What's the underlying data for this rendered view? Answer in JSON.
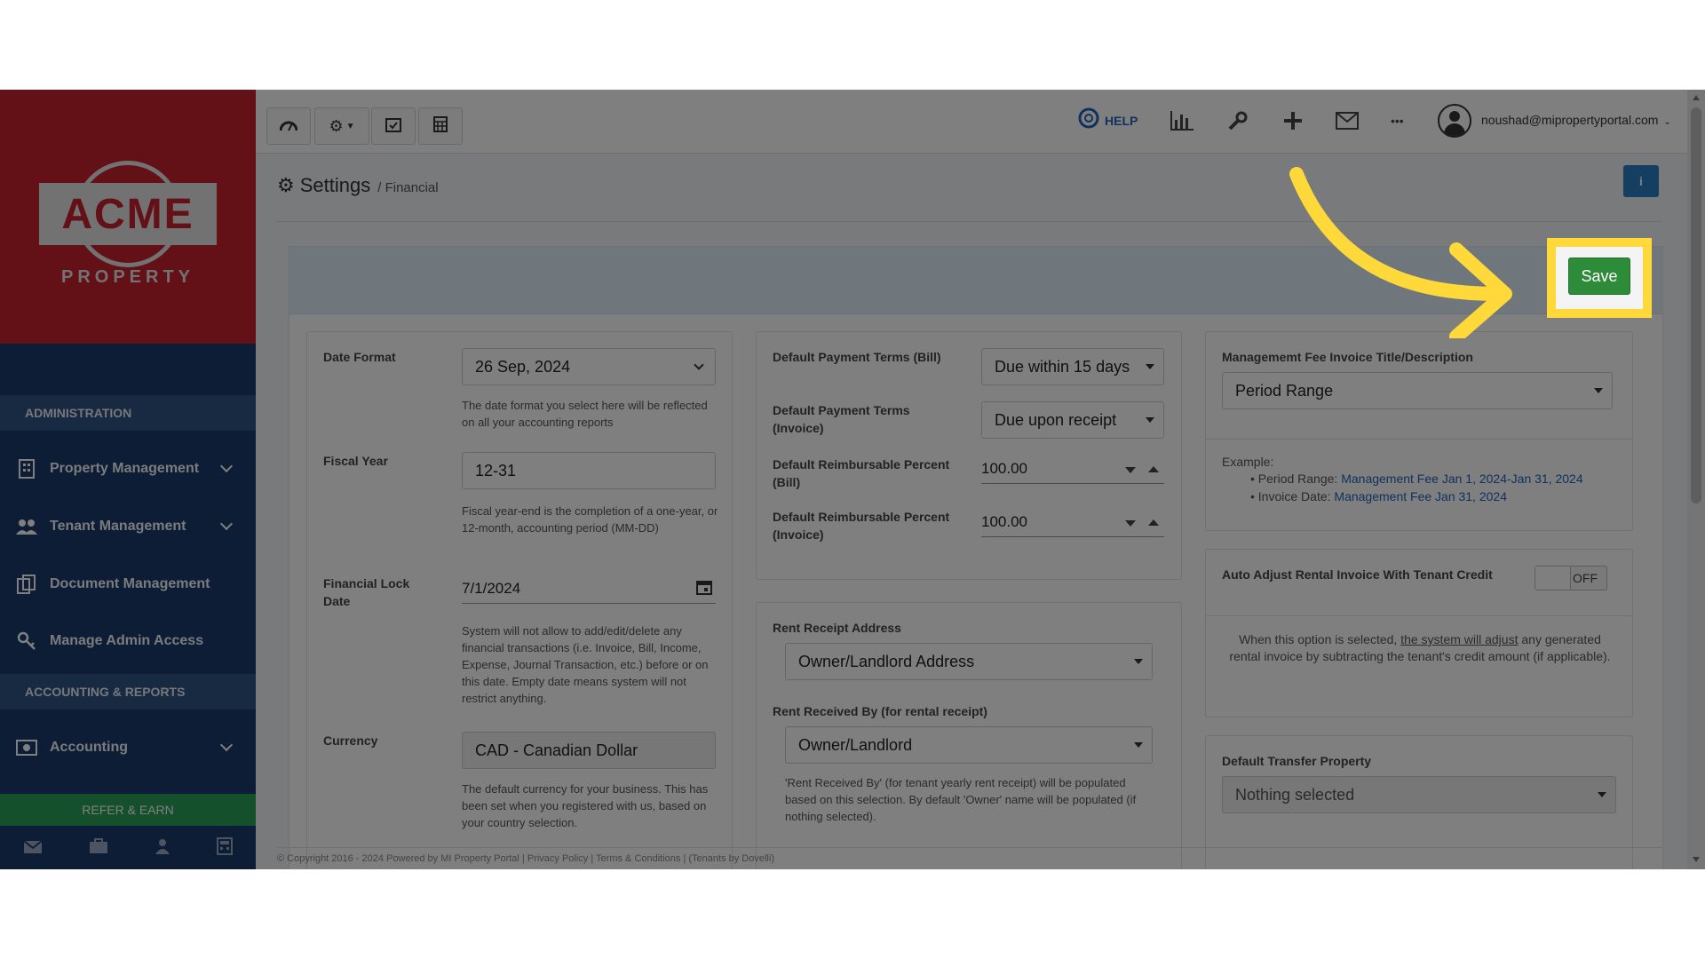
{
  "sidebar": {
    "logo_text": "ACME",
    "logo_sub": "PROPERTY",
    "sections": [
      {
        "title": "ADMINISTRATION"
      },
      {
        "title": "ACCOUNTING & REPORTS"
      }
    ],
    "items": [
      {
        "label": "Property Management",
        "icon": "building-icon"
      },
      {
        "label": "Tenant Management",
        "icon": "users-icon"
      },
      {
        "label": "Document Management",
        "icon": "documents-icon"
      },
      {
        "label": "Manage Admin Access",
        "icon": "key-icon"
      },
      {
        "label": "Accounting",
        "icon": "money-icon"
      }
    ],
    "refer_label": "REFER & EARN"
  },
  "topbar": {
    "help_label": "HELP",
    "user_email": "noushad@mipropertyportal.com",
    "more_icon_text": "•••"
  },
  "page": {
    "title": "Settings",
    "subtitle": "/ Financial",
    "info_label": "i",
    "save_label": "Save"
  },
  "col1": {
    "date_format_label": "Date Format",
    "date_format_value": "26 Sep, 2024",
    "date_format_help": "The date format you select here will be reflected on all your accounting reports",
    "fiscal_year_label": "Fiscal Year",
    "fiscal_year_value": "12-31",
    "fiscal_year_help": "Fiscal year-end is the completion of a one-year, or 12-month, accounting period (MM-DD)",
    "lock_date_label": "Financial Lock Date",
    "lock_date_value": "7/1/2024",
    "lock_date_help": "System will not allow to add/edit/delete any financial transactions (i.e. Invoice, Bill, Income, Expense, Journal Transaction, etc.) before or on this date. Empty date means system will not restrict anything.",
    "currency_label": "Currency",
    "currency_value": "CAD - Canadian Dollar",
    "currency_help": "The default currency for your business. This has been set when you registered with us, based on your country selection."
  },
  "col2": {
    "terms_bill_label": "Default Payment Terms (Bill)",
    "terms_bill_value": "Due within 15 days",
    "terms_invoice_label": "Default Payment Terms (Invoice)",
    "terms_invoice_value": "Due upon receipt",
    "reimb_bill_label": "Default Reimbursable Percent (Bill)",
    "reimb_bill_value": "100.00",
    "reimb_invoice_label": "Default Reimbursable Percent (Invoice)",
    "reimb_invoice_value": "100.00",
    "receipt_address_label": "Rent Receipt Address",
    "receipt_address_value": "Owner/Landlord Address",
    "received_by_label": "Rent Received By (for rental receipt)",
    "received_by_value": "Owner/Landlord",
    "received_by_help": "'Rent Received By' (for tenant yearly rent receipt) will be populated based on this selection. By default 'Owner' name will be populated (if nothing selected)."
  },
  "col3": {
    "fee_title_label": "Managememt Fee Invoice Title/Description",
    "fee_title_value": "Period Range",
    "example_label": "Example:",
    "example_items": [
      {
        "key": "Period Range: ",
        "value": "Management Fee Jan 1, 2024-Jan 31, 2024"
      },
      {
        "key": "Invoice Date: ",
        "value": "Management Fee Jan 31, 2024"
      }
    ],
    "auto_adjust_label": "Auto Adjust Rental Invoice With Tenant Credit",
    "auto_adjust_state": "OFF",
    "auto_adjust_help_1": "When this option is selected, ",
    "auto_adjust_help_link": "the system will adjust",
    "auto_adjust_help_2": " any generated rental invoice by subtracting the tenant's credit amount (if applicable).",
    "transfer_label": "Default Transfer Property",
    "transfer_value": "Nothing selected"
  },
  "footer": {
    "text": "© Copyright 2016 - 2024 Powered by MI Property Portal | Privacy Policy | Terms & Conditions | (Tenants by Dovelli)"
  },
  "colors": {
    "sidebar_bg": "#1b3a6b",
    "logo_bg": "#c8202e",
    "save_green": "#2e8b3a",
    "highlight_yellow": "#ffd83a"
  }
}
